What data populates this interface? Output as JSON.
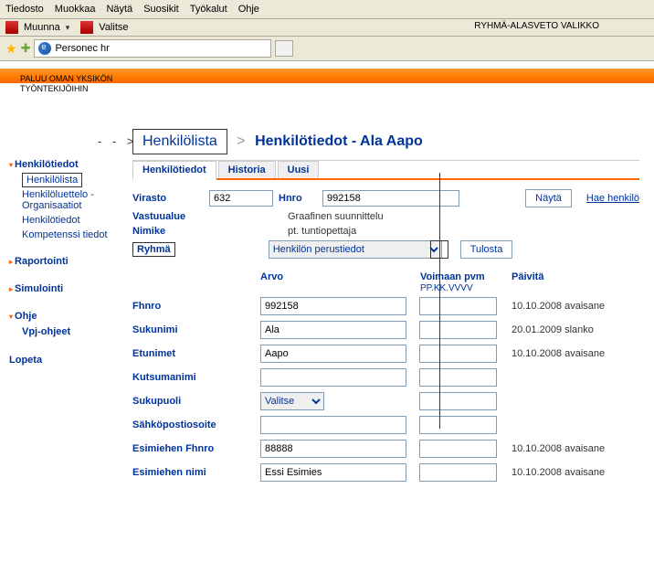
{
  "menubar": [
    "Tiedosto",
    "Muokkaa",
    "Näytä",
    "Suosikit",
    "Työkalut",
    "Ohje"
  ],
  "toolbar": {
    "muunna": "Muunna",
    "valitse": "Valitse"
  },
  "annotation_top": "RYHMÄ-ALASVETO VALIKKO",
  "page_title": "Personec hr",
  "annotation_left_line1": "PALUU OMAN YKSIKÖN",
  "annotation_left_line2": "TYÖNTEKIJÖIHIN",
  "sidebar": {
    "henkilotiedot": "Henkilötiedot",
    "henkilolista": "Henkilölista",
    "henkiloluettelo": "Henkilöluettelo - Organisaatiot",
    "henkilotiedot2": "Henkilötiedot",
    "kompetenssi": "Kompetenssi tiedot",
    "raportointi": "Raportointi",
    "simulointi": "Simulointi",
    "ohje": "Ohje",
    "vpj": "Vpj-ohjeet",
    "lopeta": "Lopeta"
  },
  "breadcrumb": {
    "list": "Henkilölista",
    "title": "Henkilötiedot - Ala Aapo"
  },
  "tabs": {
    "t1": "Henkilötiedot",
    "t2": "Historia",
    "t3": "Uusi"
  },
  "fields": {
    "virasto_label": "Virasto",
    "virasto_val": "632",
    "hnro_label": "Hnro",
    "hnro_val": "992158",
    "nayta_btn": "Näytä",
    "hae_link": "Hae henkilö",
    "vastuualue_label": "Vastuualue",
    "vastuualue_val": "Graafinen suunnittelu",
    "nimike_label": "Nimike",
    "nimike_val": "pt. tuntiopettaja",
    "ryhma_label": "Ryhmä",
    "ryhma_select": "Henkilön perustiedot",
    "tulosta_btn": "Tulosta"
  },
  "tableheaders": {
    "arvo": "Arvo",
    "voimaan": "Voimaan pvm",
    "voimaan_sub": "PP.KK.VVVV",
    "paivita": "Päivitä"
  },
  "rows": [
    {
      "label": "Fhnro",
      "arvo": "992158",
      "voim": "",
      "paiv": "10.10.2008 avaisane"
    },
    {
      "label": "Sukunimi",
      "arvo": "Ala",
      "voim": "",
      "paiv": "20.01.2009 slanko"
    },
    {
      "label": "Etunimet",
      "arvo": "Aapo",
      "voim": "",
      "paiv": "10.10.2008 avaisane"
    },
    {
      "label": "Kutsumanimi",
      "arvo": "",
      "voim": "",
      "paiv": ""
    },
    {
      "label": "Sukupuoli",
      "arvo": "Valitse",
      "voim": "",
      "paiv": "",
      "is_select": true
    },
    {
      "label": "Sähköpostiosoite",
      "arvo": "",
      "voim": "",
      "paiv": ""
    },
    {
      "label": "Esimiehen Fhnro",
      "arvo": "88888",
      "voim": "",
      "paiv": "10.10.2008 avaisane"
    },
    {
      "label": "Esimiehen nimi",
      "arvo": "Essi Esimies",
      "voim": "",
      "paiv": "10.10.2008 avaisane"
    }
  ]
}
